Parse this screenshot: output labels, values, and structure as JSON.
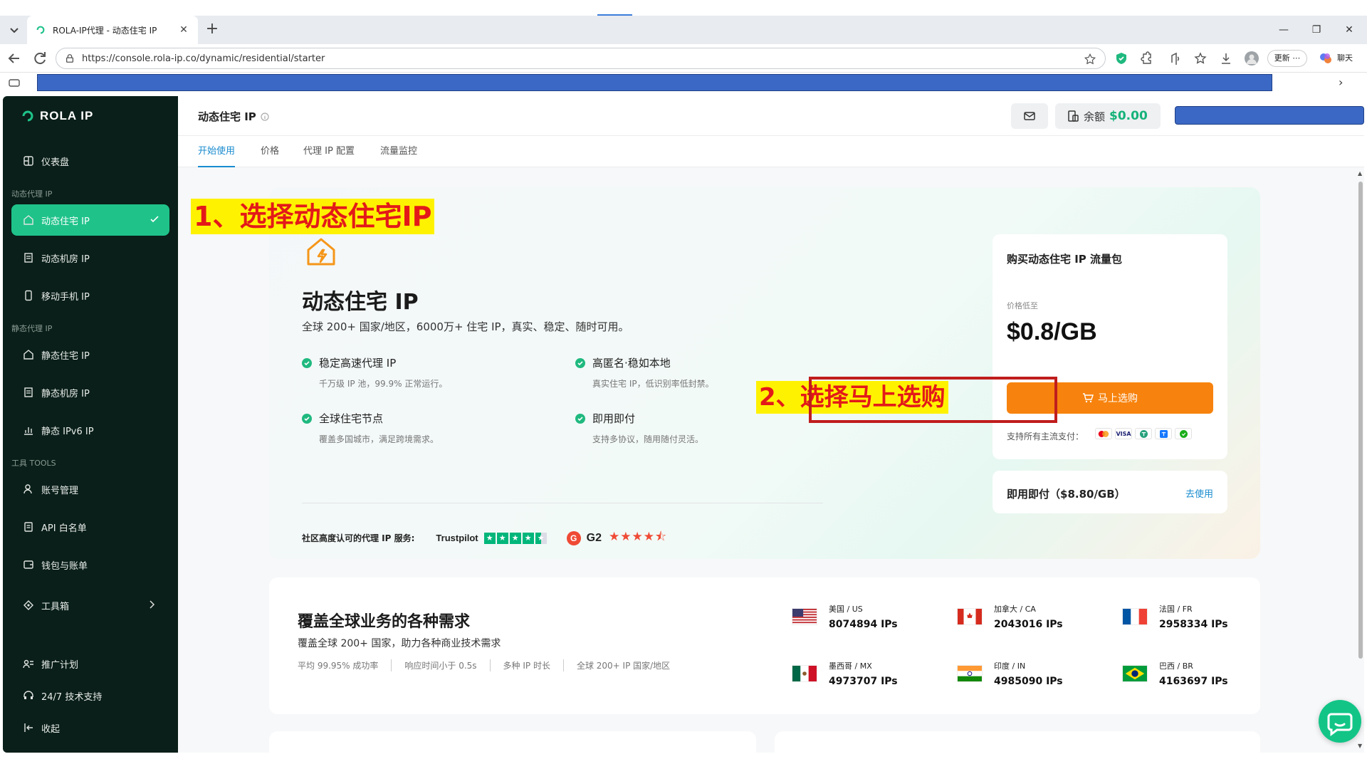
{
  "browser": {
    "tab_title": "ROLA-IP代理 - 动态住宅 IP",
    "url": "https://console.rola-ip.co/dynamic/residential/starter",
    "update_label": "更新",
    "chat_label": "聊天"
  },
  "sidebar": {
    "logo": "ROLA IP",
    "dashboard": "仪表盘",
    "group_dynamic": "动态代理 IP",
    "dynamic_items": [
      "动态住宅 IP",
      "动态机房 IP",
      "移动手机 IP"
    ],
    "group_static": "静态代理 IP",
    "static_items": [
      "静态住宅 IP",
      "静态机房 IP",
      "静态 IPv6 IP"
    ],
    "group_tools": "工具 TOOLS",
    "tools_items": [
      "账号管理",
      "API 白名单",
      "钱包与账单",
      "工具箱"
    ],
    "bottom_items": [
      "推广计划",
      "24/7 技术支持",
      "收起"
    ]
  },
  "header": {
    "title": "动态住宅 IP",
    "balance_label": "余额",
    "balance_value": "$0.00"
  },
  "tabs": [
    "开始使用",
    "价格",
    "代理 IP 配置",
    "流量监控"
  ],
  "hero": {
    "title": "动态住宅 IP",
    "desc": "全球 200+ 国家/地区，6000万+ 住宅 IP，真实、稳定、随时可用。",
    "features": [
      {
        "title": "稳定高速代理 IP",
        "desc": "千万级 IP 池，99.9% 正常运行。"
      },
      {
        "title": "高匿名·稳如本地",
        "desc": "真实住宅 IP，低识别率低封禁。"
      },
      {
        "title": "全球住宅节点",
        "desc": "覆盖多国城市，满足跨境需求。"
      },
      {
        "title": "即用即付",
        "desc": "支持多协议，随用随付灵活。"
      }
    ],
    "trust_label": "社区高度认可的代理 IP 服务:",
    "trustpilot": "Trustpilot",
    "trustpilot_rating": 4.5,
    "g2_label": "G2",
    "g2_rating": 4.5
  },
  "buy_card": {
    "title": "购买动态住宅 IP 流量包",
    "price_label": "价格低至",
    "price": "$0.8/GB",
    "buy_button": "马上选购",
    "pay_label": "支持所有主流支付："
  },
  "payg_card": {
    "title": "即用即付（$8.80/GB）",
    "link": "去使用"
  },
  "annotations": {
    "step1": "1、选择动态住宅IP",
    "step2": "2、选择马上选购"
  },
  "coverage": {
    "title": "覆盖全球业务的各种需求",
    "subtitle": "覆盖全球 200+ 国家，助力各种商业技术需求",
    "stats": [
      "平均 99.95% 成功率",
      "响应时间小于 0.5s",
      "多种 IP 时长",
      "全球 200+ IP 国家/地区"
    ],
    "countries": [
      {
        "name": "美国 / US",
        "ips": "8074894 IPs",
        "flag": "us"
      },
      {
        "name": "加拿大 / CA",
        "ips": "2043016 IPs",
        "flag": "ca"
      },
      {
        "name": "法国 / FR",
        "ips": "2958334 IPs",
        "flag": "fr"
      },
      {
        "name": "墨西哥 / MX",
        "ips": "4973707 IPs",
        "flag": "mx"
      },
      {
        "name": "印度 / IN",
        "ips": "4985090 IPs",
        "flag": "in"
      },
      {
        "name": "巴西 / BR",
        "ips": "4163697 IPs",
        "flag": "br"
      }
    ]
  },
  "colors": {
    "sidebar_bg": "#0a1f19",
    "accent_green": "#1fc38a",
    "buy_orange": "#f7830e",
    "link_blue": "#1a8ccf",
    "annotation_red": "#e31919",
    "annotation_yellow": "#fff200"
  }
}
